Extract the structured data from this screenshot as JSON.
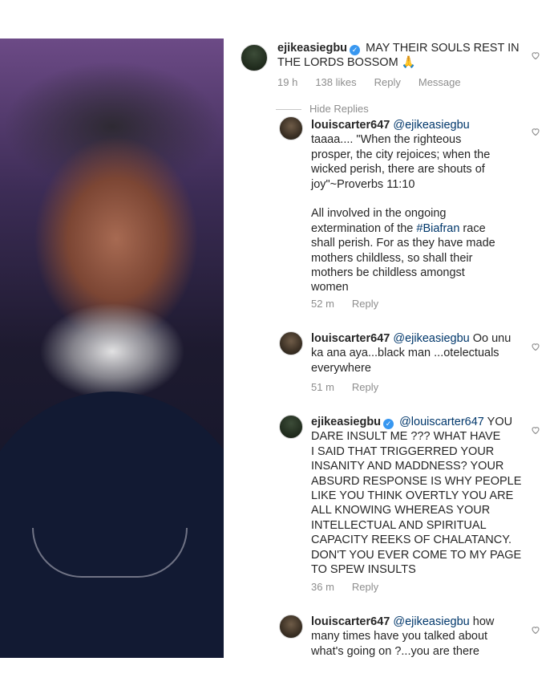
{
  "comments": [
    {
      "username": "ejikeasiegbu",
      "verified": true,
      "mention": "",
      "text_lines": [
        "MAY THEIR SOULS REST IN",
        "THE LORDS BOSSOM 🙏"
      ],
      "time": "19 h",
      "likes": "138 likes",
      "reply": "Reply",
      "message": "Message"
    },
    {
      "username": "louiscarter647",
      "mention": "@ejikeasiegbu",
      "text_lines": [
        "taaaa.... \"When the righteous",
        "prosper, the city rejoices; when the",
        "wicked perish, there are shouts of",
        "joy\"~Proverbs 11:10",
        "",
        "All involved in the ongoing",
        "extermination of the #Biafran race",
        "shall perish. For as they have made",
        "mothers childless, so shall their",
        "mothers be childless amongst",
        "women"
      ],
      "time": "52 m",
      "reply": "Reply"
    },
    {
      "username": "louiscarter647",
      "mention": "@ejikeasiegbu",
      "first_line_rest": "Oo unu",
      "text_lines": [
        "ka ana aya...black man ...otelectuals",
        "everywhere"
      ],
      "time": "51 m",
      "reply": "Reply"
    },
    {
      "username": "ejikeasiegbu",
      "verified": true,
      "mention": "@louiscarter647",
      "first_line_rest": "YOU",
      "text_lines": [
        "DARE INSULT ME ??? WHAT HAVE",
        "I SAID THAT TRIGGERRED YOUR",
        "INSANITY AND MADDNESS? YOUR",
        "ABSURD RESPONSE IS WHY PEOPLE",
        "LIKE YOU THINK OVERTLY YOU ARE",
        "ALL KNOWING WHEREAS YOUR",
        "INTELLECTUAL AND SPIRITUAL",
        "CAPACITY REEKS OF CHALATANCY.",
        "DON'T YOU EVER COME TO MY PAGE",
        "TO SPEW INSULTS"
      ],
      "time": "36 m",
      "reply": "Reply"
    },
    {
      "username": "louiscarter647",
      "mention": "@ejikeasiegbu",
      "first_line_rest": "how",
      "text_lines": [
        "many times have you talked about",
        "what's going on ?...you are there"
      ]
    }
  ],
  "hide_replies": "Hide Replies",
  "icons": {
    "verified": "verified-badge-icon",
    "heart": "heart-icon",
    "praying_hands": "praying-hands-emoji"
  },
  "colors": {
    "verified": "#3897f0",
    "mention": "#00376b",
    "meta": "#8e8e8e"
  }
}
